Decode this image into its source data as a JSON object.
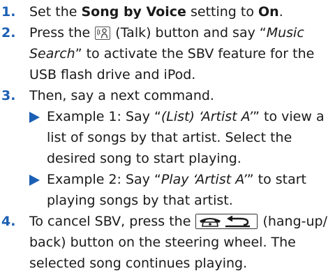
{
  "steps": [
    {
      "num": "1.",
      "pre": "Set the ",
      "bold1": "Song by Voice",
      "mid": " setting to ",
      "bold2": "On",
      "post": "."
    },
    {
      "num": "2.",
      "pre": "Press the ",
      "after_icon": " (Talk) button and say “",
      "italic": "Music Search",
      "post": "” to activate the SBV feature for the USB flash drive and iPod."
    },
    {
      "num": "3.",
      "text": "Then, say a next command.",
      "examples": [
        {
          "pre": "Example 1: Say “",
          "italic": "(List) ‘Artist A’",
          "post": "” to view a list of songs by that artist. Select the desired song to start playing."
        },
        {
          "pre": "Example 2: Say “",
          "italic": "Play ‘Artist A’",
          "post": "” to start playing songs by that artist."
        }
      ]
    },
    {
      "num": "4.",
      "pre": "To cancel SBV, press the ",
      "post": " (hang-up/ back) button on the steering wheel. The selected song continues playing."
    }
  ],
  "icons": {
    "talk": "talk-button-icon",
    "hangup": "hang-up-back-button-icon"
  },
  "colors": {
    "accent": "#1a5fb4",
    "text": "#1a1a1a"
  }
}
